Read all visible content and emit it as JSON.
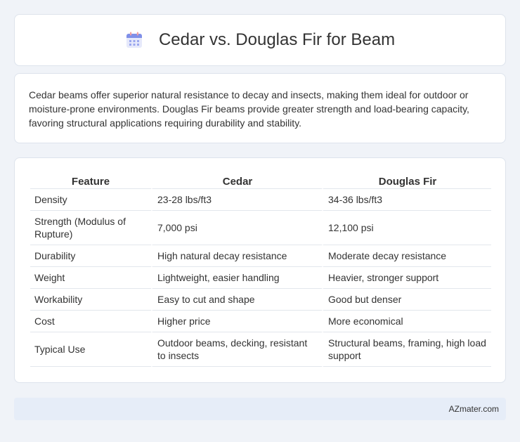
{
  "header": {
    "title": "Cedar vs. Douglas Fir for Beam",
    "icon": "calendar-icon"
  },
  "summary": {
    "text": "Cedar beams offer superior natural resistance to decay and insects, making them ideal for outdoor or moisture-prone environments. Douglas Fir beams provide greater strength and load-bearing capacity, favoring structural applications requiring durability and stability."
  },
  "table": {
    "headers": [
      "Feature",
      "Cedar",
      "Douglas Fir"
    ],
    "rows": [
      [
        "Density",
        "23-28 lbs/ft3",
        "34-36 lbs/ft3"
      ],
      [
        "Strength (Modulus of Rupture)",
        "7,000 psi",
        "12,100 psi"
      ],
      [
        "Durability",
        "High natural decay resistance",
        "Moderate decay resistance"
      ],
      [
        "Weight",
        "Lightweight, easier handling",
        "Heavier, stronger support"
      ],
      [
        "Workability",
        "Easy to cut and shape",
        "Good but denser"
      ],
      [
        "Cost",
        "Higher price",
        "More economical"
      ],
      [
        "Typical Use",
        "Outdoor beams, decking, resistant to insects",
        "Structural beams, framing, high load support"
      ]
    ]
  },
  "footer": {
    "brand": "AZmater.com"
  }
}
